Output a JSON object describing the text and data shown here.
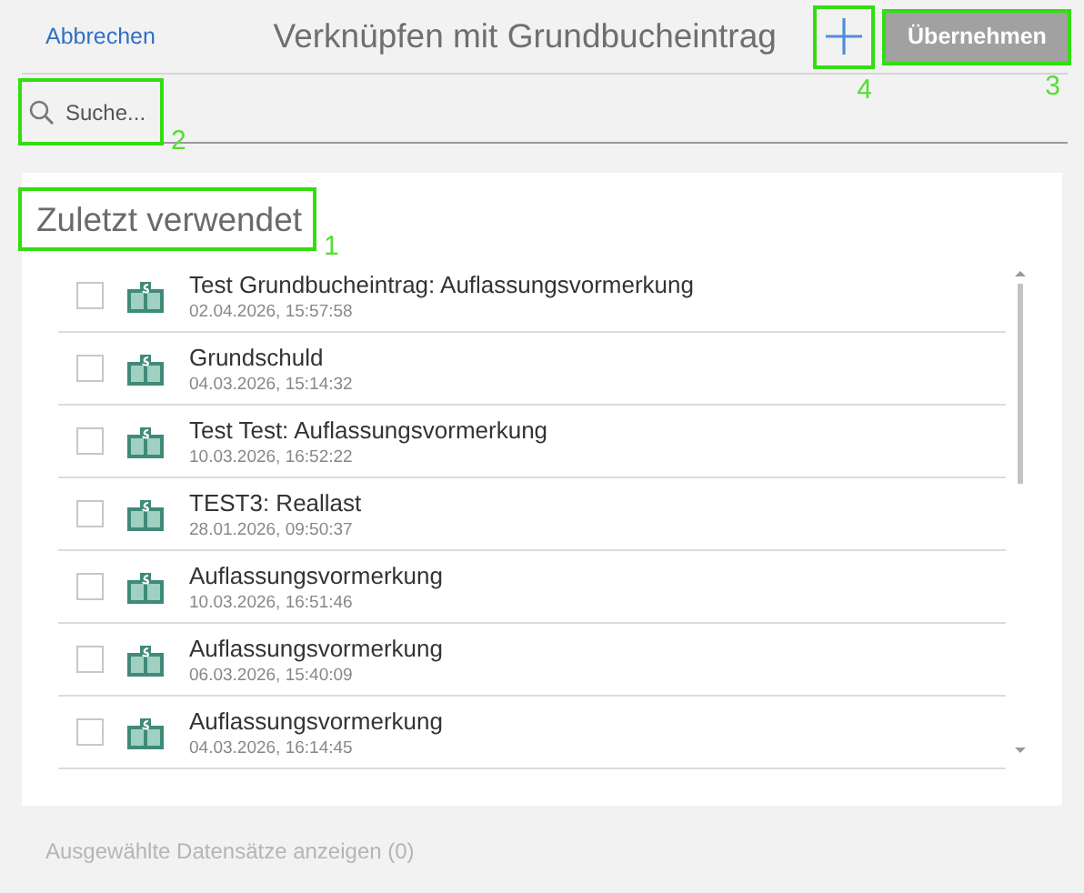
{
  "header": {
    "cancel": "Abbrechen",
    "title": "Verknüpfen mit Grundbucheintrag",
    "add_callout": "4",
    "apply": {
      "label": "Übernehmen",
      "disabled": true,
      "callout": "3"
    }
  },
  "search": {
    "placeholder": "Suche...",
    "callout": "2"
  },
  "recent": {
    "title": "Zuletzt verwendet",
    "callout": "1",
    "items": [
      {
        "name": "Test Grundbucheintrag: Auflassungsvormerkung",
        "date": "02.04.2026, 15:57:58",
        "checked": false
      },
      {
        "name": "Grundschuld",
        "date": "04.03.2026, 15:14:32",
        "checked": false
      },
      {
        "name": "Test Test: Auflassungsvormerkung",
        "date": "10.03.2026, 16:52:22",
        "checked": false
      },
      {
        "name": "TEST3: Reallast",
        "date": "28.01.2026, 09:50:37",
        "checked": false
      },
      {
        "name": "Auflassungsvormerkung",
        "date": "10.03.2026, 16:51:46",
        "checked": false
      },
      {
        "name": "Auflassungsvormerkung",
        "date": "06.03.2026, 15:40:09",
        "checked": false
      },
      {
        "name": "Auflassungsvormerkung",
        "date": "04.03.2026, 16:14:45",
        "checked": false
      }
    ]
  },
  "footer": {
    "show_selected": "Ausgewählte Datensätze anzeigen (0)",
    "disabled": true
  }
}
